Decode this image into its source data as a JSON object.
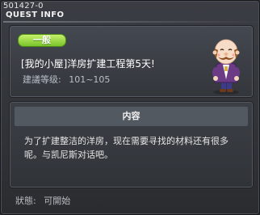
{
  "quest": {
    "id": "501427-0",
    "window_title": "QUEST INFO",
    "category": "一般",
    "title": "[我的小屋]洋房扩建工程第5天!",
    "level_label": "建議等级:",
    "level_range": "101~105"
  },
  "content": {
    "header": "内容",
    "text": "为了扩建整洁的洋房，现在需要寻找的材料还有很多呢。与凯尼斯对话吧。"
  },
  "status": {
    "label": "狀態:",
    "value": "可開始"
  },
  "colors": {
    "window_bg": "#2b2d31",
    "badge_green": "#8ccf2e",
    "text_white": "#ffffff"
  },
  "icons": {
    "npc": "npc-portrait-icon"
  }
}
